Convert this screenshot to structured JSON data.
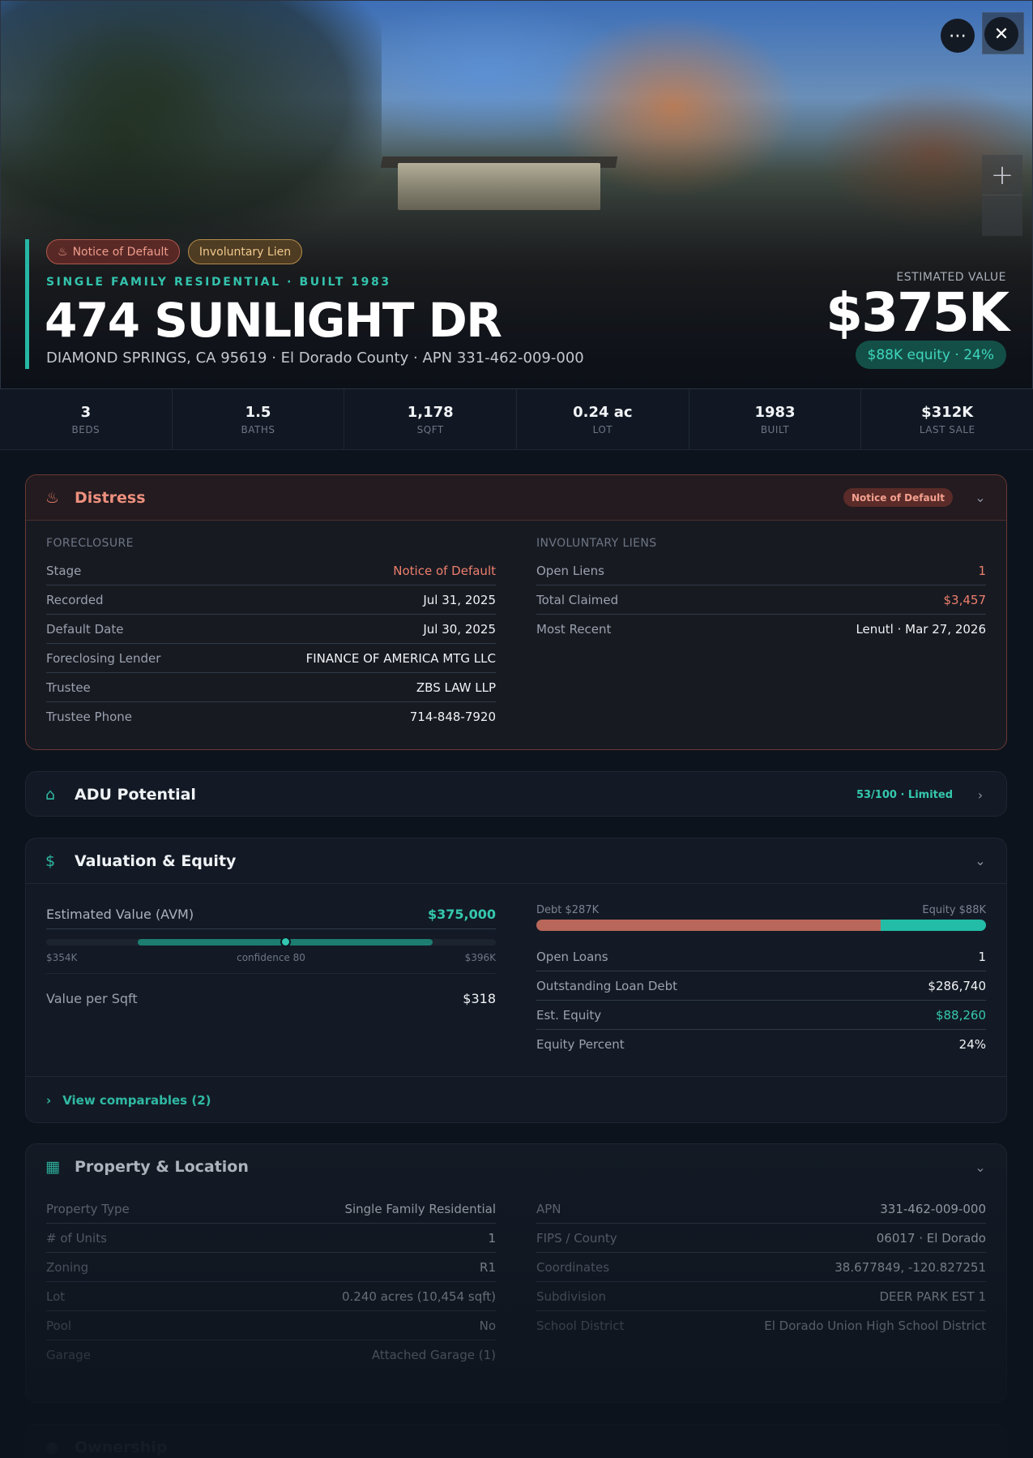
{
  "hero": {
    "badges": [
      {
        "label": "Notice of Default",
        "icon": "flame-icon"
      },
      {
        "label": "Involuntary Lien"
      }
    ],
    "eyebrow": "SINGLE FAMILY RESIDENTIAL · BUILT 1983",
    "title": "474 SUNLIGHT DR",
    "subtitle": "DIAMOND SPRINGS, CA 95619 · El Dorado County · APN 331-462-009-000",
    "estimated_label": "ESTIMATED VALUE",
    "estimated_value": "$375K",
    "equity_pill": "$88K equity · 24%",
    "accent_color": "#26b7a5"
  },
  "stats": [
    {
      "value": "3",
      "label": "BEDS"
    },
    {
      "value": "1.5",
      "label": "BATHS"
    },
    {
      "value": "1,178",
      "label": "SQFT"
    },
    {
      "value": "0.24 ac",
      "label": "LOT"
    },
    {
      "value": "1983",
      "label": "BUILT"
    },
    {
      "value": "$312K",
      "label": "LAST SALE"
    }
  ],
  "distress": {
    "title": "Distress",
    "chip": "Notice of Default",
    "foreclosure_label": "FORECLOSURE",
    "foreclosure": [
      {
        "k": "Stage",
        "v": "Notice of Default"
      },
      {
        "k": "Recorded",
        "v": "Jul 31, 2025"
      },
      {
        "k": "Default Date",
        "v": "Jul 30, 2025"
      },
      {
        "k": "Foreclosing Lender",
        "v": "FINANCE OF AMERICA MTG LLC"
      },
      {
        "k": "Trustee",
        "v": "ZBS LAW LLP"
      },
      {
        "k": "Trustee Phone",
        "v": "714-848-7920"
      }
    ],
    "liens_label": "INVOLUNTARY LIENS",
    "liens": [
      {
        "k": "Open Liens",
        "v": "1"
      },
      {
        "k": "Total Claimed",
        "v": "$3,457"
      },
      {
        "k": "Most Recent",
        "v": "Lenutl · Mar 27, 2026"
      }
    ]
  },
  "adu": {
    "title": "ADU Potential",
    "score": "53/100 · Limited"
  },
  "valuation": {
    "title": "Valuation & Equity",
    "avm_label": "Estimated Value (AVM)",
    "avm_value": "$375,000",
    "range_low": "$354K",
    "range_high": "$396K",
    "confidence": "confidence 80",
    "vps_label": "Value per Sqft",
    "vps_value": "$318",
    "debt_label": "Debt $287K",
    "equity_label": "Equity $88K",
    "debt_fraction": 0.765,
    "loans": [
      {
        "k": "Open Loans",
        "v": "1"
      },
      {
        "k": "Outstanding Loan Debt",
        "v": "$286,740"
      },
      {
        "k": "Est. Equity",
        "v": "$88,260"
      },
      {
        "k": "Equity Percent",
        "v": "24%"
      }
    ],
    "comparables": "View comparables (2)"
  },
  "property": {
    "title": "Property & Location",
    "left": [
      {
        "k": "Property Type",
        "v": "Single Family Residential"
      },
      {
        "k": "# of Units",
        "v": "1"
      },
      {
        "k": "Zoning",
        "v": "R1"
      },
      {
        "k": "Lot",
        "v": "0.240 acres (10,454 sqft)"
      },
      {
        "k": "Pool",
        "v": "No"
      },
      {
        "k": "Garage",
        "v": "Attached Garage (1)"
      }
    ],
    "right": [
      {
        "k": "APN",
        "v": "331-462-009-000"
      },
      {
        "k": "FIPS / County",
        "v": "06017 · El Dorado"
      },
      {
        "k": "Coordinates",
        "v": "38.677849, -120.827251"
      },
      {
        "k": "Subdivision",
        "v": "DEER PARK EST 1"
      },
      {
        "k": "School District",
        "v": "El Dorado Union High School District"
      }
    ]
  },
  "ownership": {
    "title": "Ownership"
  }
}
